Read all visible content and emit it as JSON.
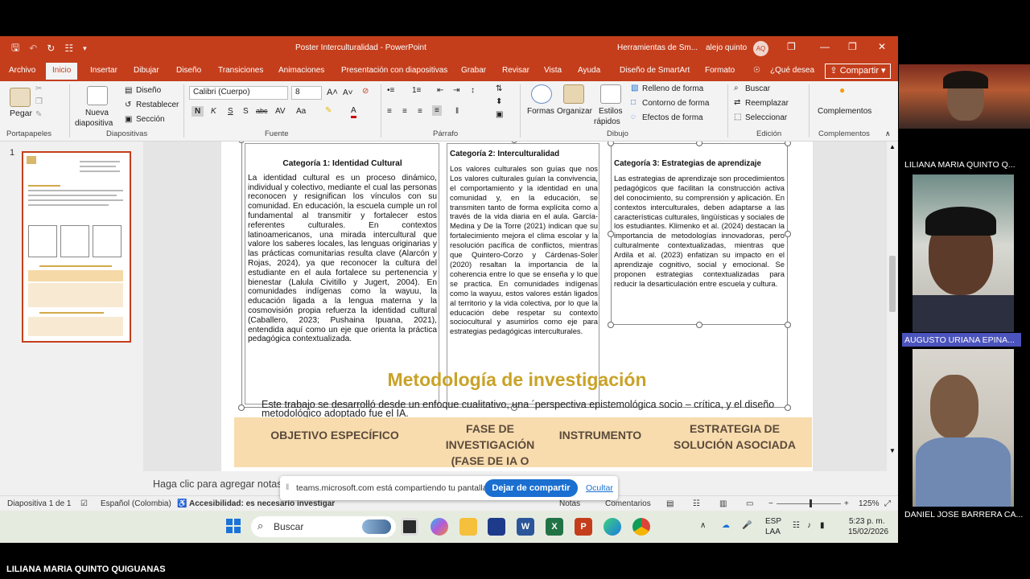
{
  "window": {
    "doc_title": "Poster Interculturalidad  -  PowerPoint",
    "tools_title": "Herramientas de Sm...",
    "user": "alejo quinto",
    "user_initials": "AQ"
  },
  "tabs": [
    "Archivo",
    "Inicio",
    "Insertar",
    "Dibujar",
    "Diseño",
    "Transiciones",
    "Animaciones",
    "Presentación con diapositivas",
    "Grabar",
    "Revisar",
    "Vista",
    "Ayuda",
    "Diseño de SmartArt",
    "Formato",
    "¿Qué desea"
  ],
  "share_label": "Compartir",
  "ribbon": {
    "pegar": "Pegar",
    "nueva": "Nueva",
    "diapositiva": "diapositiva",
    "diseno": "Diseño",
    "restablecer": "Restablecer",
    "seccion": "Sección",
    "font_name": "Calibri (Cuerpo)",
    "font_size": "8",
    "formas": "Formas",
    "organizar": "Organizar",
    "estilos": "Estilos",
    "rapidos": "rápidos",
    "relleno": "Relleno de forma",
    "contorno": "Contorno de forma",
    "efectos": "Efectos de forma",
    "buscar": "Buscar",
    "reemplazar": "Reemplazar",
    "seleccionar": "Seleccionar",
    "complementos": "Complementos",
    "groups": {
      "portapapeles": "Portapapeles",
      "diapositivas": "Diapositivas",
      "fuente": "Fuente",
      "parrafo": "Párrafo",
      "dibujo": "Dibujo",
      "edicion": "Edición",
      "complementos": "Complementos"
    }
  },
  "slide": {
    "number": "1",
    "cat1_title": "Categoría 1: Identidad Cultural",
    "cat1_text": "La identidad cultural es un proceso dinámico, individual y colectivo, mediante el cual las personas reconocen y resignifican los vínculos con su comunidad. En educación, la escuela cumple un rol fundamental al transmitir y fortalecer estos referentes culturales. En contextos latinoamericanos, una mirada intercultural que valore los saberes locales, las lenguas originarias y las prácticas comunitarias resulta clave (Alarcón y Rojas, 2024), ya que reconocer la cultura del estudiante en el aula fortalece su pertenencia y bienestar (Lalula Civitillo y Jugert, 2004). En comunidades indígenas como la wayuu, la educación ligada a la lengua materna y la cosmovisión propia refuerza la identidad cultural (Caballero, 2023; Pushaina Ipuana, 2021), entendida aquí como un eje que orienta la práctica pedagógica contextualizada.",
    "cat2_title": "Categoría 2: Interculturalidad",
    "cat2_text": "Los valores culturales son guías que nos Los valores culturales guían la convivencia, el comportamiento y la identidad en una comunidad y, en la educación, se transmiten tanto de forma explícita como a través de la vida diaria en el aula. García-Medina y De la Torre (2021) indican que su fortalecimiento mejora el clima escolar y la resolución pacífica de conflictos, mientras que Quintero-Corzo y Cárdenas-Soler (2020) resaltan la importancia de la coherencia entre lo que se enseña y lo que se practica. En comunidades indígenas como la wayuu, estos valores están ligados al territorio y la vida colectiva, por lo que la educación debe respetar su contexto sociocultural y asumirlos como eje para estrategias pedagógicas interculturales.",
    "cat3_title": "Categoría 3: Estrategias de aprendizaje",
    "cat3_text": "Las estrategias de aprendizaje son procedimientos pedagógicos que facilitan la construcción activa del conocimiento, su comprensión y aplicación. En contextos interculturales, deben adaptarse a las características culturales, lingüísticas y sociales de los estudiantes. Klimenko et al. (2024) destacan la importancia de metodologías innovadoras, pero culturalmente contextualizadas, mientras que Ardila et al. (2023) enfatizan su impacto en el aprendizaje cognitivo, social y emocional. Se proponen estrategias contextualizadas para reducir la desarticulación entre escuela y cultura.",
    "metod_title": "Metodología de investigación",
    "metod_text": "Este trabajo se desarrolló desde un enfoque cualitativo, una ´perspectiva epistemológica socio – crítica, y el diseño metodológico adoptado fue el IA.",
    "table_headers": [
      "OBJETIVO ESPECÍFICO",
      "FASE DE INVESTIGACIÓN (FASE DE IA O",
      "INSTRUMENTO",
      "ESTRATEGIA DE SOLUCIÓN ASOCIADA"
    ]
  },
  "notes_placeholder": "Haga clic para agregar notas",
  "sharebar": {
    "text": "teams.microsoft.com está compartiendo tu pantalla.",
    "stop": "Dejar de compartir",
    "hide": "Ocultar"
  },
  "status": {
    "slide": "Diapositiva 1 de 1",
    "language": "Español (Colombia)",
    "accessibility": "Accesibilidad: es necesario investigar",
    "notes": "Notas",
    "comments": "Comentarios",
    "zoom": "125%"
  },
  "taskbar": {
    "search": "Buscar",
    "lang1": "ESP",
    "lang2": "LAA",
    "time": "5:23 p. m.",
    "date": "15/02/2026"
  },
  "participants": [
    "LILIANA MARIA QUINTO Q...",
    "AUGUSTO  URIANA EPINA...",
    "DANIEL JOSE BARRERA CA..."
  ],
  "active_speaker": "LILIANA MARIA QUINTO QUIGUANAS",
  "colors": {
    "brand": "#c43e1c",
    "teams_blue": "#1a6fd1",
    "heading_gold": "#c9a227",
    "table_header": "#f8dcae"
  }
}
